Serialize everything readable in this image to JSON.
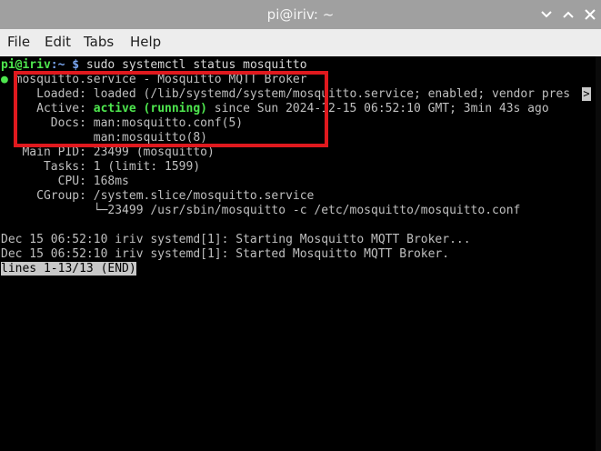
{
  "window": {
    "title": "pi@iriv: ~"
  },
  "menu": [
    "File",
    "Edit",
    "Tabs",
    "Help"
  ],
  "prompt": {
    "user_host": "pi@iriv",
    "path": ":~ $",
    "command": " sudo systemctl status mosquitto"
  },
  "status": {
    "dot": "●",
    "unit_line": " mosquitto.service - Mosquitto MQTT Broker",
    "loaded": "     Loaded: loaded (/lib/systemd/system/mosquitto.service; enabled; vendor pres",
    "active_label": "     Active: ",
    "active_state": "active (running)",
    "active_rest": " since Sun 2024-12-15 06:52:10 GMT; 3min 43s ago",
    "docs1": "       Docs: man:mosquitto.conf(5)",
    "docs2": "             man:mosquitto(8)",
    "main_pid": "   Main PID: 23499 (mosquitto)",
    "tasks": "      Tasks: 1 (limit: 1599)",
    "cpu": "        CPU: 168ms",
    "cgroup": "     CGroup: /system.slice/mosquitto.service",
    "cgroup_proc": "             └─23499 /usr/sbin/mosquitto -c /etc/mosquitto/mosquitto.conf"
  },
  "log": [
    "Dec 15 06:52:10 iriv systemd[1]: Starting Mosquitto MQTT Broker...",
    "Dec 15 06:52:10 iriv systemd[1]: Started Mosquitto MQTT Broker."
  ],
  "pager_status": "lines 1-13/13 (END)",
  "truncation_marker": ">",
  "icons": {
    "minimize": "minimize-icon",
    "maximize": "maximize-icon",
    "close": "close-icon"
  },
  "colors": {
    "titlebar": "#a0a0a0",
    "menubar": "#ededed",
    "terminal_bg": "#000000",
    "prompt_green": "#4ee64e",
    "prompt_blue": "#7aa6f0",
    "highlight_red": "#e0191e"
  }
}
